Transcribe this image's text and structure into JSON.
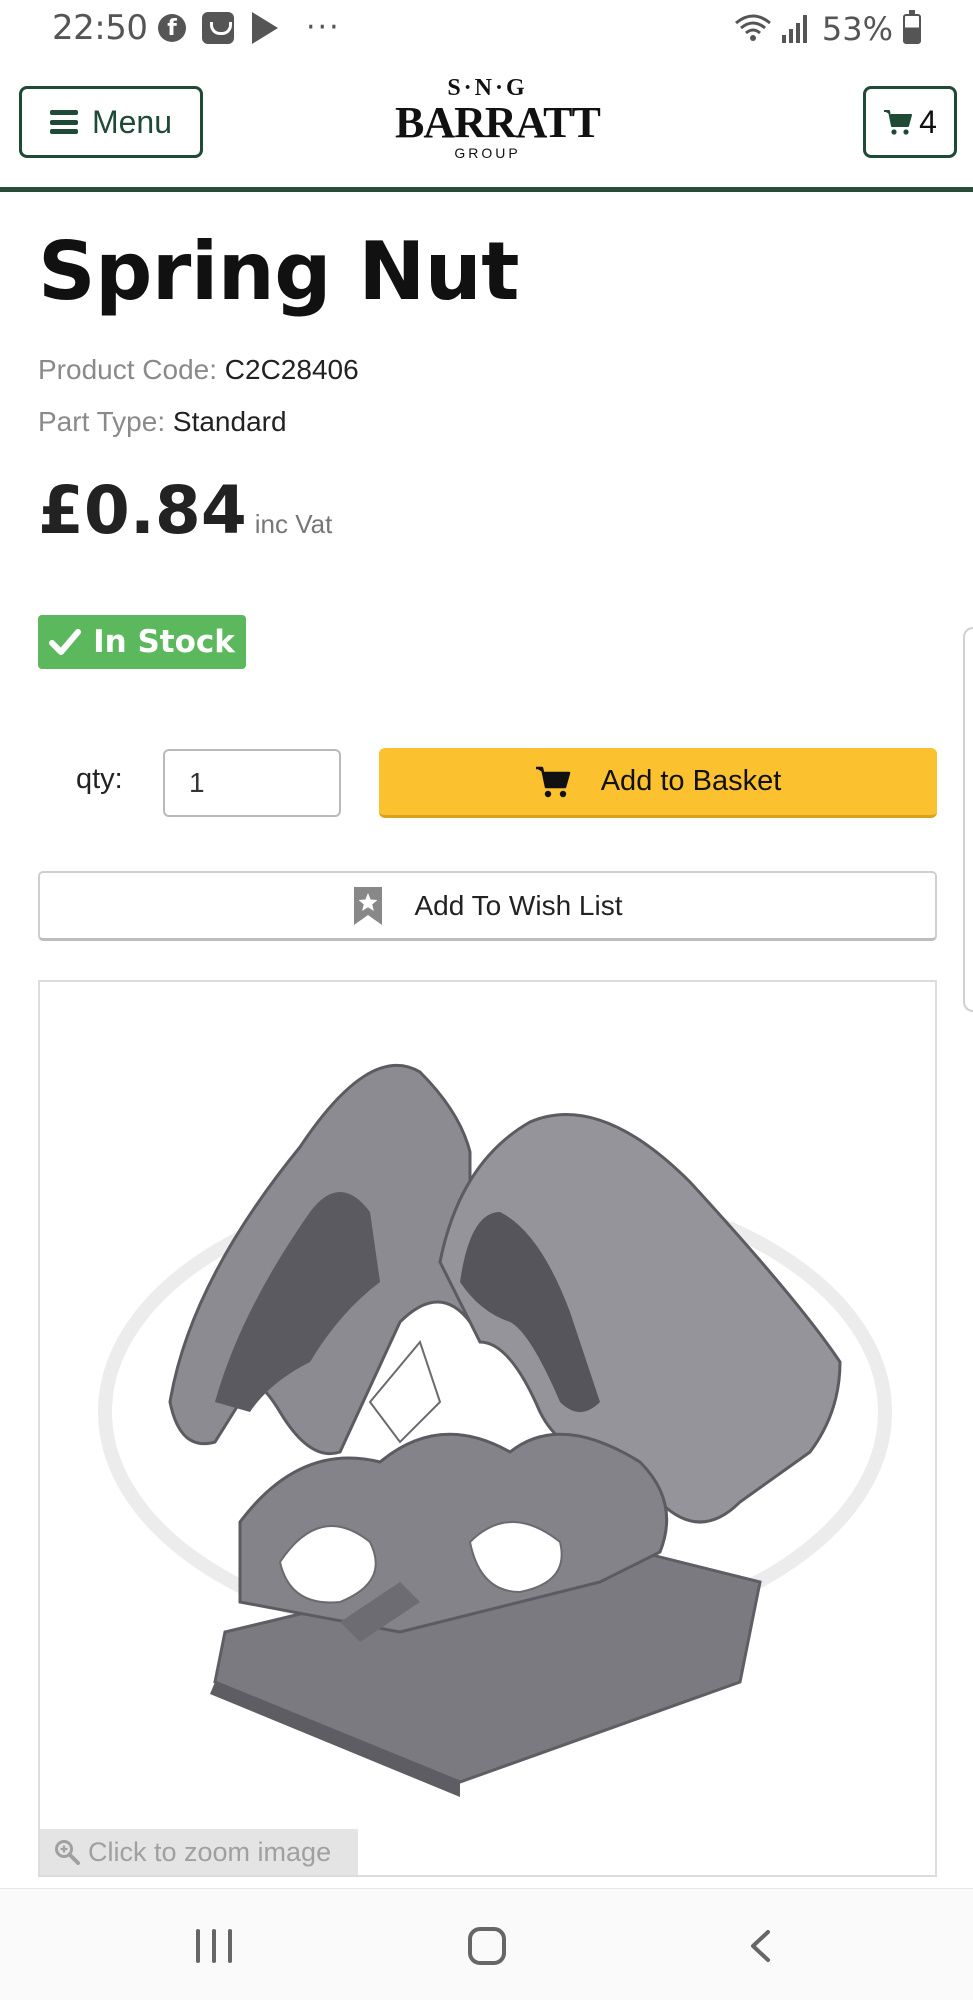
{
  "status_bar": {
    "time": "22:50",
    "battery": "53%",
    "left_icons": [
      "facebook-icon",
      "app-icon",
      "play-icon",
      "more-dots-icon"
    ],
    "right_icons": [
      "wifi-icon",
      "signal-icon",
      "battery-icon"
    ],
    "dots": "···"
  },
  "header": {
    "menu_label": "Menu",
    "logo_top": "S·N·G",
    "logo_main": "BARRATT",
    "logo_sub": "GROUP",
    "cart_count": "4",
    "accent": "#1e4a36"
  },
  "product": {
    "title": "Spring Nut",
    "code_label": "Product Code:",
    "code_value": "C2C28406",
    "type_label": "Part Type:",
    "type_value": "Standard",
    "price": "£0.84",
    "price_suffix": "inc Vat",
    "stock_label": "In Stock",
    "stock_color": "#5cb85c"
  },
  "purchase": {
    "qty_label": "qty:",
    "qty_value": "1",
    "add_to_basket_label": "Add to Basket",
    "basket_color": "#fcc12e",
    "wish_list_label": "Add To Wish List"
  },
  "image_panel": {
    "zoom_hint": "Click to zoom image"
  },
  "nav_bar": {
    "icons": [
      "recent-apps-icon",
      "home-icon",
      "back-icon"
    ]
  }
}
